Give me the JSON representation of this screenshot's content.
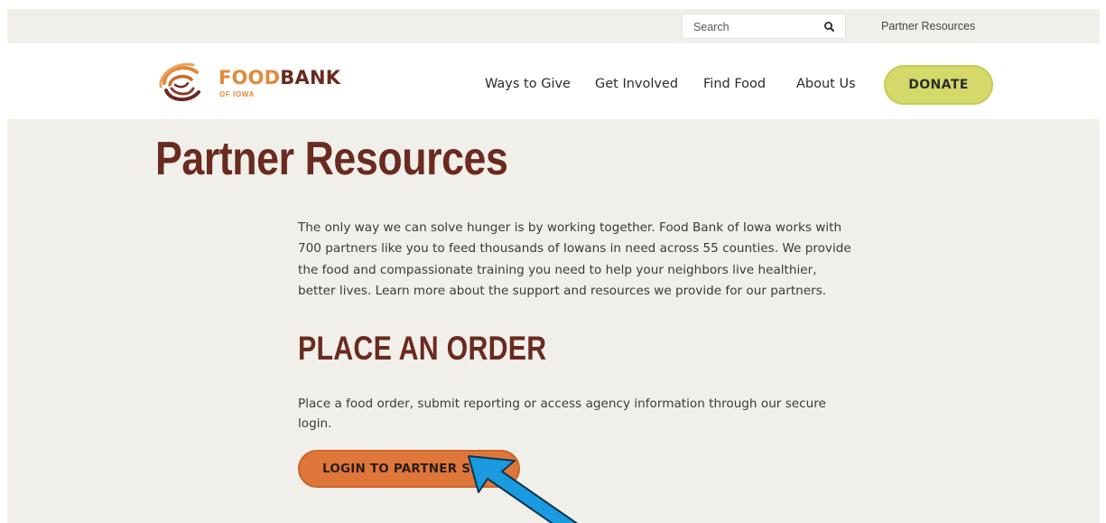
{
  "utility_bar": {
    "search_placeholder": "Search",
    "search_icon": "magnifier-icon",
    "partner_link": "Partner Resources"
  },
  "brand": {
    "word_part1": "FOOD",
    "word_part2": "BANK",
    "sub": "OF IOWA",
    "colors": {
      "orange": "#e08a3c",
      "brown": "#6a2a1f"
    }
  },
  "nav": {
    "items": [
      "Ways to Give",
      "Get Involved",
      "Find Food",
      "About Us"
    ],
    "donate": "DONATE"
  },
  "page": {
    "title": "Partner Resources",
    "intro": "The only way we can solve hunger is by working together. Food Bank of Iowa works with 700 partners like you to feed thousands of Iowans in need across 55 counties. We provide the food and compassionate training you need to help your neighbors live healthier, better lives. Learn more about the support and resources we provide for our partners.",
    "order_section": {
      "heading": "PLACE AN ORDER",
      "text": "Place a food order, submit reporting or access agency information through our secure login.",
      "button": "LOGIN TO PARTNER SITE"
    }
  },
  "annotation": {
    "type": "arrow-icon",
    "color": "#1a9be0"
  },
  "colors": {
    "background": "#f1efea",
    "accent_green": "#d4d96a",
    "cta_orange": "#e0773a"
  }
}
